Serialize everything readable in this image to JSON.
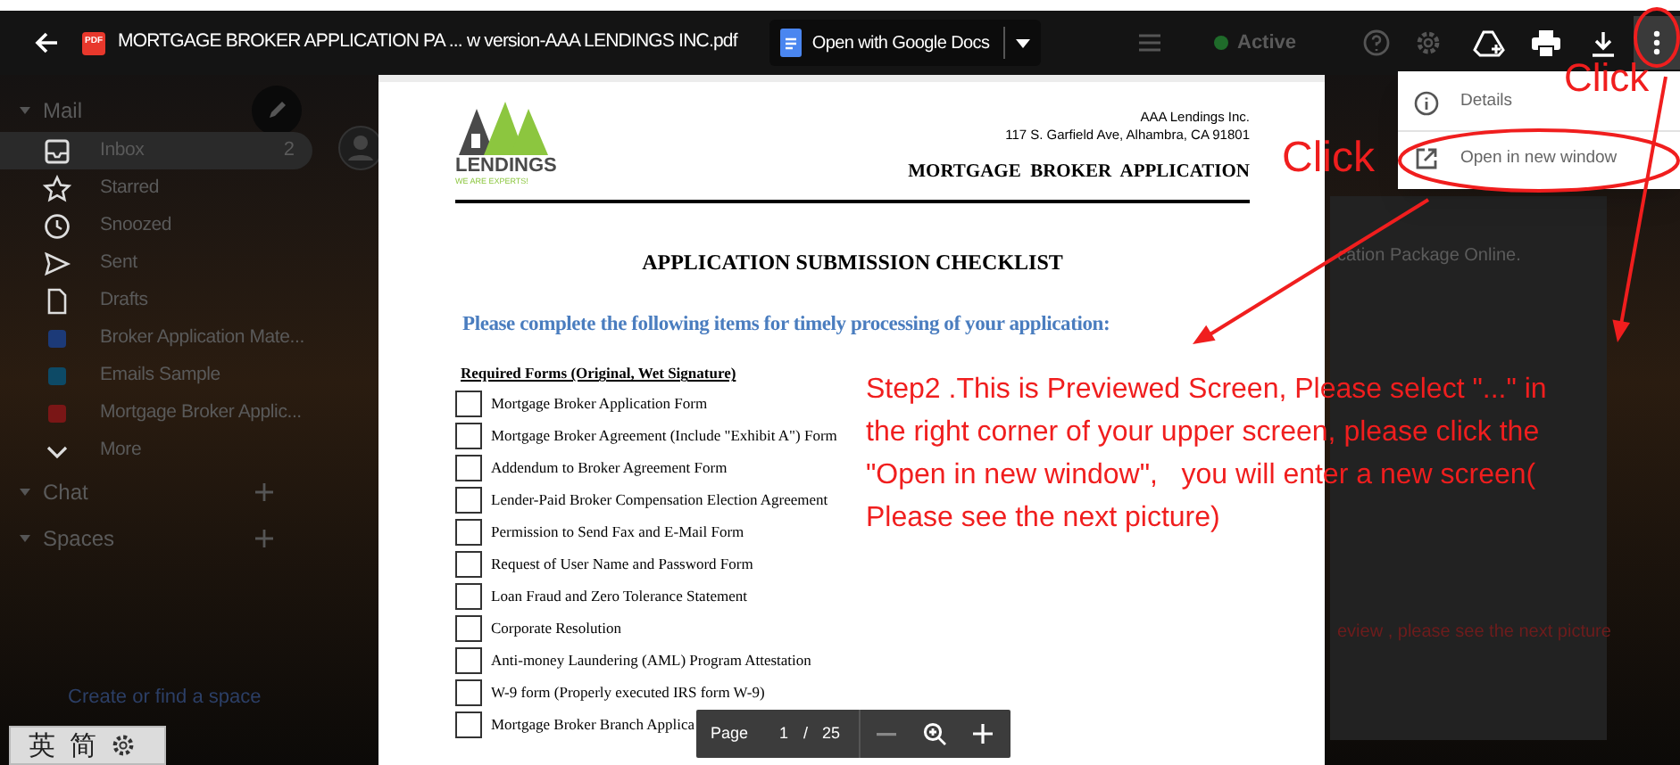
{
  "background": {
    "mail_title": "Mail",
    "items": [
      {
        "kind": "inbox",
        "label": "Inbox",
        "count": "2",
        "selected": true
      },
      {
        "kind": "starred",
        "label": "Starred",
        "selected": false
      },
      {
        "kind": "snoozed",
        "label": "Snoozed",
        "selected": false
      },
      {
        "kind": "sent",
        "label": "Sent",
        "selected": false
      },
      {
        "kind": "drafts",
        "label": "Drafts",
        "selected": false
      },
      {
        "kind": "label",
        "label": "Broker Application Mate...",
        "color": "#1c3a78",
        "selected": false
      },
      {
        "kind": "label",
        "label": "Emails Sample",
        "color": "#0d4a66",
        "selected": false
      },
      {
        "kind": "label",
        "label": "Mortgage Broker Applic...",
        "color": "#7a1616",
        "selected": false
      },
      {
        "kind": "more",
        "label": "More",
        "selected": false
      }
    ],
    "sections": [
      "Chat",
      "Spaces"
    ],
    "space_link": "Create or find a space",
    "status": "Active",
    "panel_texts": [
      "cation Package Online.",
      "eview , please see the next picture"
    ]
  },
  "viewer": {
    "file_badge": "PDF",
    "title": "MORTGAGE BROKER APPLICATION PA ... w version-AAA LENDINGS INC.pdf",
    "open_with": "Open with Google Docs"
  },
  "menu": {
    "items": [
      {
        "kind": "info",
        "label": "Details"
      },
      {
        "kind": "external",
        "label": "Open in new window"
      }
    ]
  },
  "document": {
    "logo_word": "LENDINGS",
    "logo_tagline": "WE ARE EXPERTS!",
    "company": "AAA Lendings Inc.",
    "address": "117 S. Garfield Ave, Alhambra, CA 91801",
    "form_title": "MORTGAGE  BROKER  APPLICATION",
    "heading": "APPLICATION SUBMISSION CHECKLIST",
    "instruction": "Please complete the following items for timely processing of your application:",
    "section": "Required Forms (Original, Wet Signature)",
    "items": [
      {
        "label": "Mortgage Broker Application Form",
        "checked": false
      },
      {
        "label": "Mortgage Broker Agreement (Include \"Exhibit A\") Form",
        "checked": false
      },
      {
        "label": "Addendum to Broker Agreement Form",
        "checked": false
      },
      {
        "label": "Lender-Paid Broker Compensation Election Agreement",
        "checked": false
      },
      {
        "label": "Permission to Send Fax and E-Mail Form",
        "checked": false
      },
      {
        "label": "Request of User Name and Password Form",
        "checked": false
      },
      {
        "label": "Loan Fraud and Zero Tolerance Statement",
        "checked": false
      },
      {
        "label": "Corporate Resolution",
        "checked": false
      },
      {
        "label": "Anti-money Laundering (AML) Program Attestation",
        "checked": false
      },
      {
        "label": "W-9 form (Properly executed IRS form W-9)",
        "checked": false
      },
      {
        "label": "Mortgage Broker Branch Applica",
        "checked": false
      }
    ]
  },
  "pager": {
    "label": "Page",
    "current": "1",
    "separator": "/",
    "total": "25"
  },
  "annotations": {
    "click_menu": "Click",
    "click_item": "Click",
    "step_text": "Step2 .This is Previewed Screen, Please select \"...\" in\nthe right corner of your upper screen, please click the\n\"Open in new window\",   you will enter a new screen(\nPlease see the next picture)"
  },
  "ime_bar": {
    "chars": [
      "英",
      "简"
    ]
  }
}
